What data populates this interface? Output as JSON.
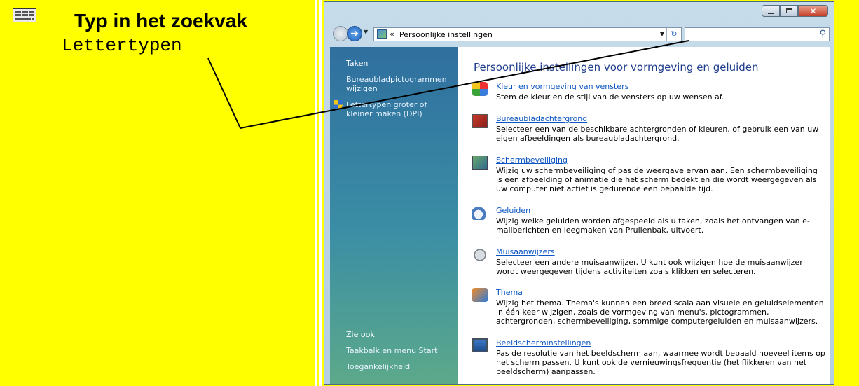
{
  "instruction": {
    "title": "Typ in het zoekvak",
    "input_text": "Lettertypen"
  },
  "window": {
    "controls": {
      "minimize": "–",
      "maximize": "□",
      "close": "✕"
    },
    "address": {
      "separator": "«",
      "text": "Persoonlijke instellingen"
    },
    "search": {
      "placeholder": "",
      "value": ""
    }
  },
  "left_pane": {
    "tasks_heading": "Taken",
    "tasks": [
      {
        "label": "Bureaubladpictogrammen wijzigen"
      },
      {
        "label": "Lettertypen groter of kleiner maken (DPI)"
      }
    ],
    "see_also_heading": "Zie ook",
    "see_also": [
      {
        "label": "Taakbalk en menu Start"
      },
      {
        "label": "Toegankelijkheid"
      }
    ]
  },
  "content": {
    "title": "Persoonlijke instellingen voor vormgeving en geluiden",
    "items": [
      {
        "icon": "color-palette-icon",
        "link": "Kleur en vormgeving van vensters",
        "desc": "Stem de kleur en de stijl van de vensters op uw wensen af."
      },
      {
        "icon": "desktop-background-icon",
        "link": "Bureaubladachtergrond",
        "desc": "Selecteer een van de beschikbare achtergronden of kleuren, of gebruik een van uw eigen afbeeldingen als bureaubladachtergrond."
      },
      {
        "icon": "screensaver-icon",
        "link": "Schermbeveiliging",
        "desc": "Wijzig uw schermbeveiliging of pas de weergave ervan aan. Een schermbeveiliging is een afbeelding of animatie die het scherm bedekt en die wordt weergegeven als uw computer niet actief is gedurende een bepaalde tijd."
      },
      {
        "icon": "sound-icon",
        "link": "Geluiden",
        "desc": "Wijzig welke geluiden worden afgespeeld als u taken, zoals het ontvangen van e-mailberichten en leegmaken van Prullenbak, uitvoert."
      },
      {
        "icon": "mouse-pointer-icon",
        "link": "Muisaanwijzers",
        "desc": "Selecteer een andere muisaanwijzer. U kunt ook wijzigen hoe de muisaanwijzer wordt weergegeven tijdens activiteiten zoals klikken en selecteren."
      },
      {
        "icon": "theme-icon",
        "link": "Thema",
        "desc": "Wijzig het thema. Thema's kunnen een breed scala aan visuele en geluidselementen in één keer wijzigen, zoals de vormgeving van menu's, pictogrammen, achtergronden, schermbeveiliging, sommige computergeluiden en muisaanwijzers."
      },
      {
        "icon": "display-settings-icon",
        "link": "Beeldscherminstellingen",
        "desc": "Pas de resolutie van het beeldscherm aan, waarmee wordt bepaald hoeveel items op het scherm passen. U kunt ook de vernieuwingsfrequentie (het flikkeren van het beeldscherm) aanpassen."
      }
    ]
  },
  "colors": {
    "highlight": "#ffff00",
    "link": "#0b56c4",
    "title": "#1e3d8c"
  }
}
